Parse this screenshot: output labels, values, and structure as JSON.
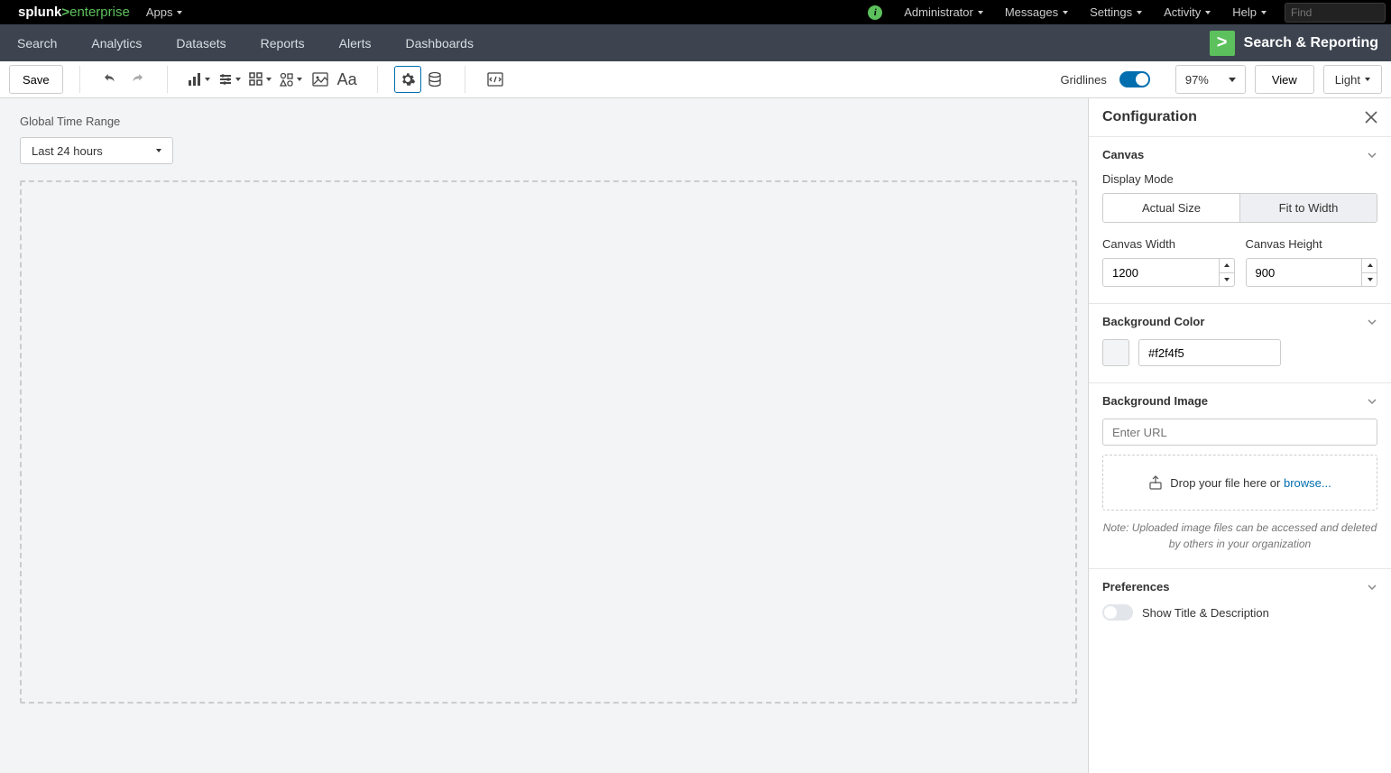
{
  "topbar": {
    "logo_parts": {
      "a": "splunk",
      "b": ">",
      "c": "enterprise"
    },
    "apps": "Apps",
    "right": {
      "admin": "Administrator",
      "messages": "Messages",
      "settings": "Settings",
      "activity": "Activity",
      "help": "Help",
      "find_placeholder": "Find"
    }
  },
  "subbar": {
    "tabs": [
      "Search",
      "Analytics",
      "Datasets",
      "Reports",
      "Alerts",
      "Dashboards"
    ],
    "app_label": "Search & Reporting"
  },
  "toolbar": {
    "save": "Save",
    "gridlines": "Gridlines",
    "zoom": "97%",
    "view": "View",
    "theme": "Light"
  },
  "canvas": {
    "time_label": "Global Time Range",
    "time_value": "Last 24 hours"
  },
  "config": {
    "title": "Configuration",
    "canvas_section": {
      "title": "Canvas",
      "display_mode_label": "Display Mode",
      "actual": "Actual Size",
      "fit": "Fit to Width",
      "width_label": "Canvas Width",
      "height_label": "Canvas Height",
      "width": "1200",
      "height": "900"
    },
    "bgcolor_section": {
      "title": "Background Color",
      "value": "#f2f4f5"
    },
    "bgimage_section": {
      "title": "Background Image",
      "url_placeholder": "Enter URL",
      "drop_text": "Drop your file here or ",
      "browse": "browse...",
      "note": "Note: Uploaded image files can be accessed and deleted by others in your organization"
    },
    "prefs_section": {
      "title": "Preferences",
      "show_title": "Show Title & Description"
    }
  }
}
